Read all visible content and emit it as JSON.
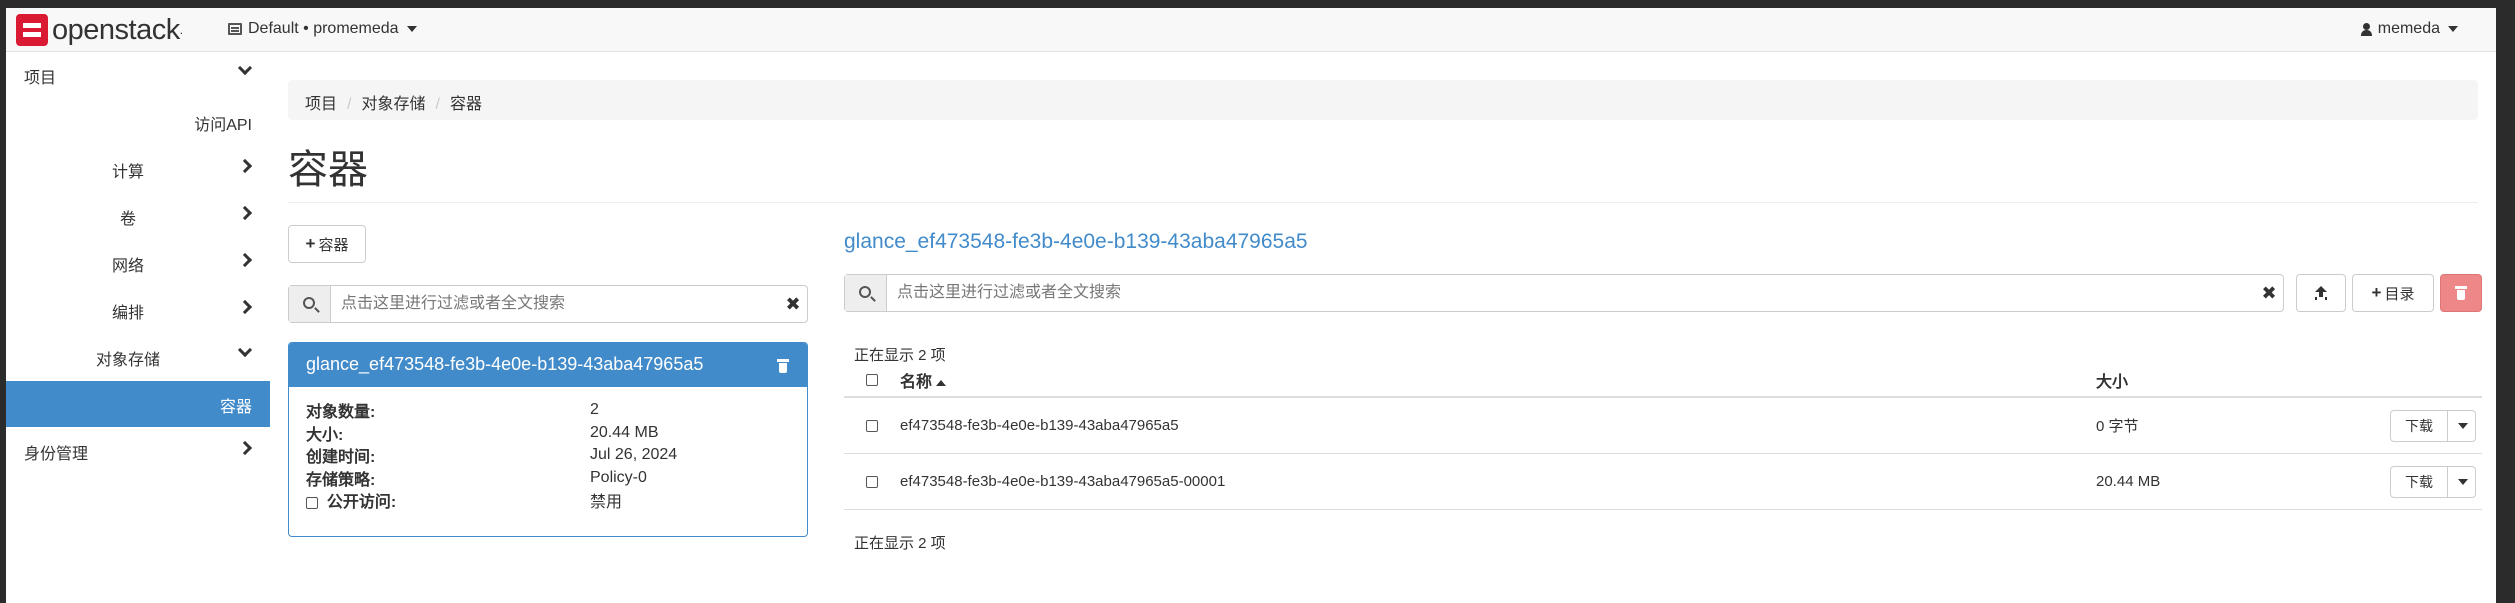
{
  "navbar": {
    "brand": "openstack",
    "project_picker": "Default • promemeda",
    "user": "memeda"
  },
  "sidebar": {
    "items": [
      {
        "label": "项目",
        "chevron": "down"
      },
      {
        "label": "访问API",
        "chevron": "none"
      },
      {
        "label": "计算",
        "chevron": "right"
      },
      {
        "label": "卷",
        "chevron": "right"
      },
      {
        "label": "网络",
        "chevron": "right"
      },
      {
        "label": "编排",
        "chevron": "right"
      },
      {
        "label": "对象存储",
        "chevron": "down"
      },
      {
        "label": "容器",
        "chevron": "none",
        "active": true
      },
      {
        "label": "身份管理",
        "chevron": "right"
      }
    ]
  },
  "breadcrumb": [
    "项目",
    "对象存储",
    "容器"
  ],
  "page_title": "容器",
  "containers_panel": {
    "add_button": "容器",
    "search_placeholder": "点击这里进行过滤或者全文搜索",
    "selected": {
      "name": "glance_ef473548-fe3b-4e0e-b139-43aba47965a5",
      "details": [
        {
          "key": "对象数量:",
          "value": "2"
        },
        {
          "key": "大小:",
          "value": "20.44 MB"
        },
        {
          "key": "创建时间:",
          "value": "Jul 26, 2024"
        },
        {
          "key": "存储策略:",
          "value": "Policy-0"
        }
      ],
      "public_access_label": "公开访问:",
      "public_access_value": "禁用"
    }
  },
  "objects_panel": {
    "container_name": "glance_ef473548-fe3b-4e0e-b139-43aba47965a5",
    "search_placeholder": "点击这里进行过滤或者全文搜索",
    "folder_button": "目录",
    "count_top": "正在显示 2 项",
    "count_bottom": "正在显示 2 项",
    "columns": {
      "name": "名称",
      "size": "大小"
    },
    "rows": [
      {
        "name": "ef473548-fe3b-4e0e-b139-43aba47965a5",
        "size": "0 字节",
        "action": "下载"
      },
      {
        "name": "ef473548-fe3b-4e0e-b139-43aba47965a5-00001",
        "size": "20.44 MB",
        "action": "下载"
      }
    ]
  },
  "colors": {
    "accent": "#428bca",
    "brand": "#da1a32",
    "danger": "#e88888"
  }
}
